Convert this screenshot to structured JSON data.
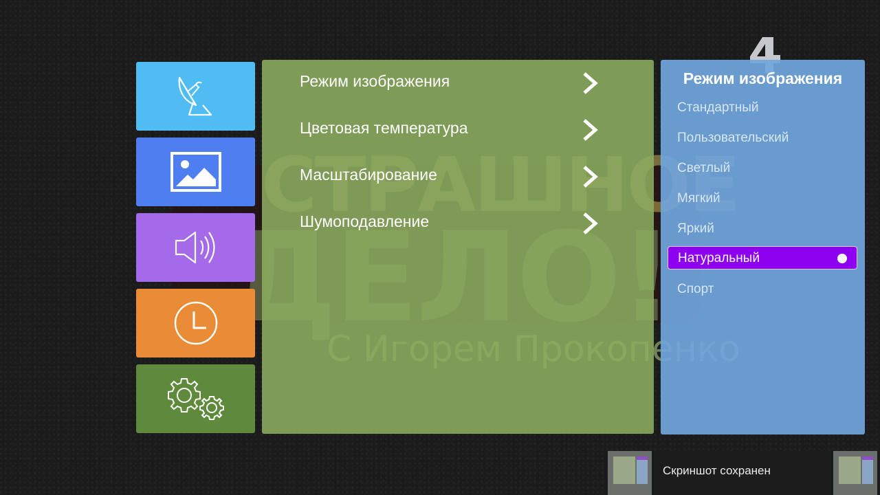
{
  "background": {
    "show_title_line1": "СТРАШНОЕ",
    "show_title_line2": "ДЕЛО!",
    "show_subtitle": "С Игорем Прокопенко"
  },
  "sidebar": {
    "items": [
      {
        "icon": "satellite-dish-icon",
        "color": "#4fbdf4"
      },
      {
        "icon": "picture-icon",
        "color": "#4f7ef0"
      },
      {
        "icon": "speaker-icon",
        "color": "#a56ae9"
      },
      {
        "icon": "clock-icon",
        "color": "#ea8b36"
      },
      {
        "icon": "gears-icon",
        "color": "#5f8a3c"
      }
    ]
  },
  "menu": {
    "items": [
      {
        "label": "Режим изображения"
      },
      {
        "label": "Цветовая температура"
      },
      {
        "label": "Масштабирование"
      },
      {
        "label": "Шумоподавление"
      }
    ]
  },
  "options": {
    "title": "Режим изображения",
    "items": [
      {
        "label": "Стандартный"
      },
      {
        "label": "Пользовательский"
      },
      {
        "label": "Светлый"
      },
      {
        "label": "Мягкий"
      },
      {
        "label": "Яркий"
      },
      {
        "label": "Натуральный"
      },
      {
        "label": "Спорт"
      }
    ],
    "selected_index": 5,
    "selected_color": "#8e00f0"
  },
  "toast": {
    "message": "Скриншот сохранен"
  }
}
